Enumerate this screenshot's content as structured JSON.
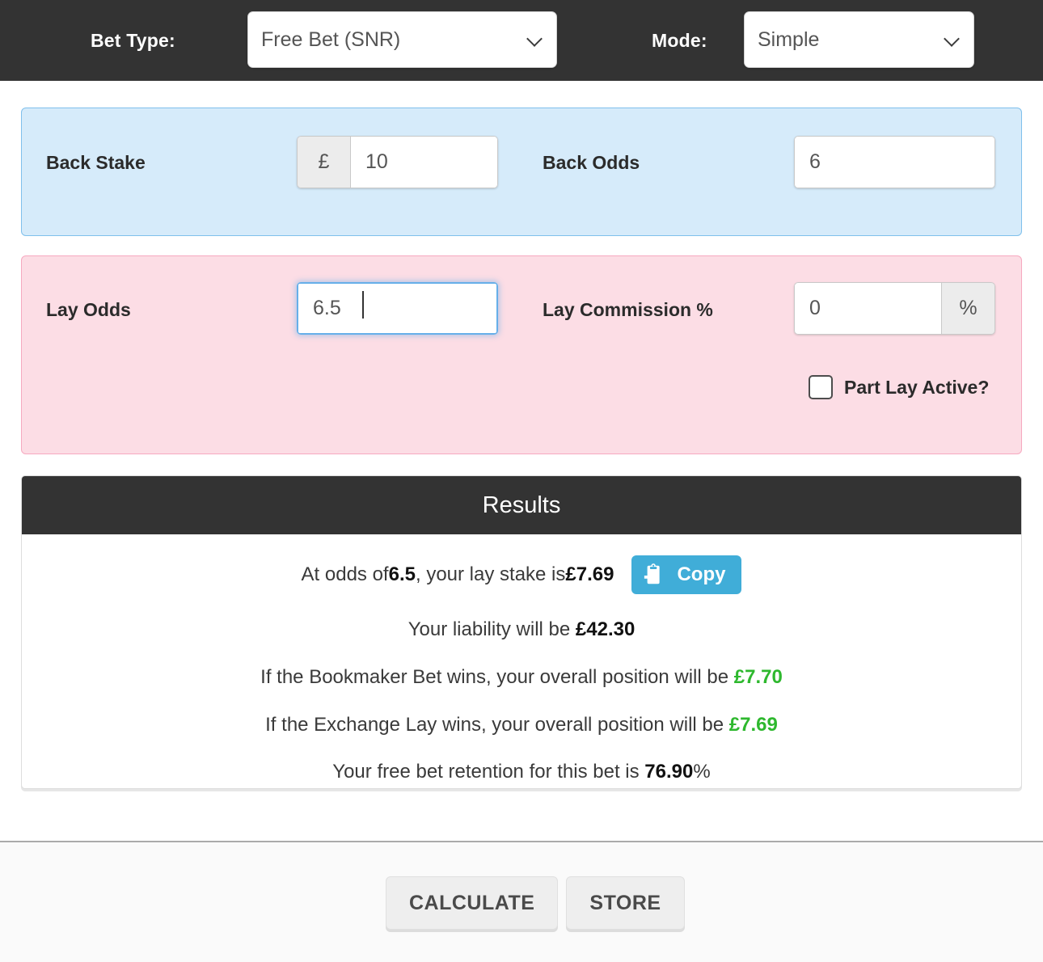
{
  "topbar": {
    "bet_type_label": "Bet Type:",
    "bet_type_value": "Free Bet (SNR)",
    "mode_label": "Mode:",
    "mode_value": "Simple",
    "chevron_icon": "chevron-down-icon",
    "background_color": "#333333"
  },
  "back_section": {
    "background_color": "#d6ebfa",
    "border_color": "#7fc0ec",
    "back_stake_label": "Back Stake",
    "back_stake_currency": "£",
    "back_stake_value": "10",
    "back_odds_label": "Back Odds",
    "back_odds_value": "6"
  },
  "lay_section": {
    "background_color": "#fcdde5",
    "border_color": "#f6a9c0",
    "lay_odds_label": "Lay Odds",
    "lay_odds_value": "6.5",
    "lay_commission_label": "Lay Commission %",
    "lay_commission_value": "0",
    "lay_commission_suffix": "%",
    "part_lay_label": "Part Lay Active?",
    "part_lay_checked": false,
    "focus_border_color": "#66afe9"
  },
  "results": {
    "title": "Results",
    "header_background": "#333333",
    "positive_color": "#2eb82e",
    "copy_button_color": "#40add8",
    "lay_stake_line": {
      "prefix": "At odds of ",
      "odds": "6.5",
      "middle": ", your lay stake is ",
      "amount": "£7.69"
    },
    "copy_button_label": "Copy",
    "copy_icon": "clipboard-paste-icon",
    "liability_line": {
      "prefix": "Your liability will be ",
      "amount": "£42.30"
    },
    "bookmaker_line": {
      "prefix": "If the Bookmaker Bet wins, your overall position will be ",
      "amount": "£7.70"
    },
    "exchange_line": {
      "prefix": "If the Exchange Lay wins, your overall position will be ",
      "amount": "£7.69"
    },
    "retention_line": {
      "prefix": "Your free bet retention for this bet is ",
      "amount": "76.90",
      "suffix": "%"
    }
  },
  "footer": {
    "calculate_label": "CALCULATE",
    "store_label": "STORE",
    "background_color": "#fafafa"
  }
}
